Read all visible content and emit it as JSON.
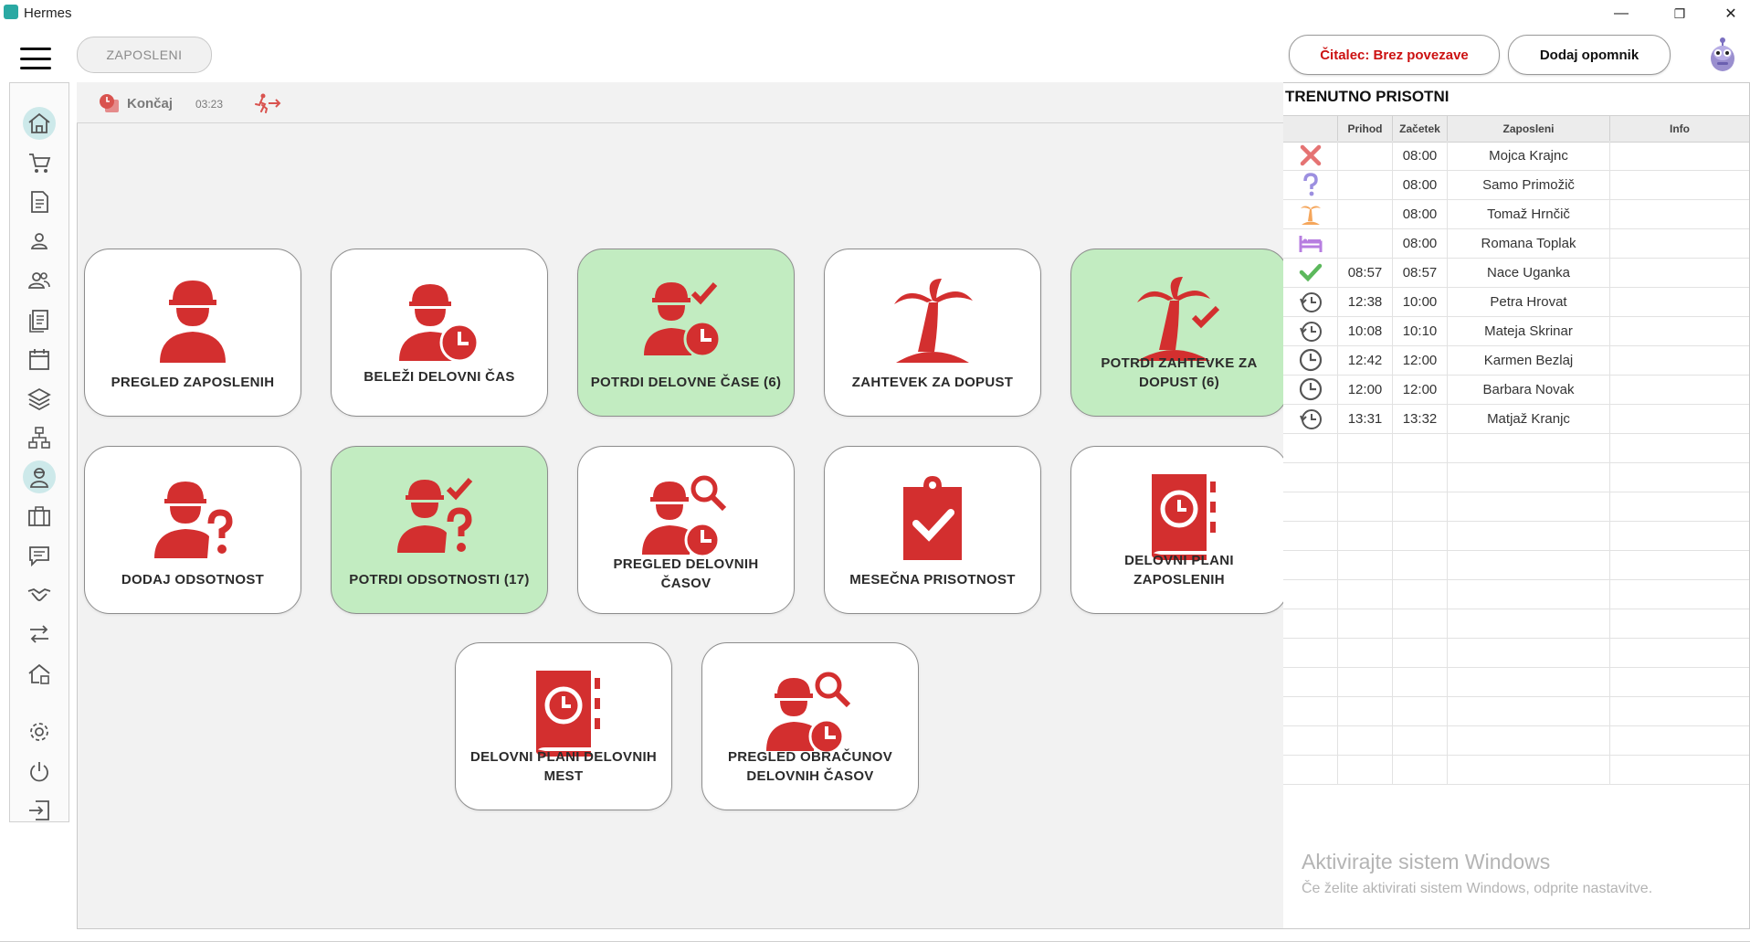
{
  "window": {
    "title": "Hermes",
    "minimize": "—",
    "maximize": "❐",
    "close": "✕"
  },
  "header": {
    "tab_label": "ZAPOSLENI",
    "reader_label": "Čitalec: Brez povezave",
    "reminder_label": "Dodaj opomnik"
  },
  "sidebar": {
    "items": [
      "home-icon",
      "cart-icon",
      "document-icon",
      "person-icon",
      "people-icon",
      "list-icon",
      "calendar-icon",
      "layers-icon",
      "hierarchy-icon",
      "employee-icon",
      "briefcase-icon",
      "chat-icon",
      "handshake-icon",
      "transfer-icon",
      "house-icon",
      "settings-icon",
      "power-icon",
      "logout-icon"
    ],
    "active": "employee-icon"
  },
  "toolbar": {
    "end_label": "Končaj",
    "time": "03:23"
  },
  "tiles": [
    {
      "label": "PREGLED ZAPOSLENIH",
      "icon": "worker-icon",
      "green": false
    },
    {
      "label": "BELEŽI DELOVNI ČAS",
      "icon": "worker-clock-icon",
      "green": false
    },
    {
      "label": "POTRDI DELOVNE ČASE (6)",
      "icon": "worker-clock-check-icon",
      "green": true
    },
    {
      "label": "ZAHTEVEK ZA DOPUST",
      "icon": "palm-icon",
      "green": false
    },
    {
      "label": "POTRDI ZAHTEVKE ZA DOPUST (6)",
      "icon": "palm-check-icon",
      "green": true
    },
    {
      "label": "DODAJ ODSOTNOST",
      "icon": "worker-question-icon",
      "green": false
    },
    {
      "label": "POTRDI ODSOTNOSTI (17)",
      "icon": "worker-question-check-icon",
      "green": true
    },
    {
      "label": "PREGLED DELOVNIH ČASOV",
      "icon": "worker-search-clock-icon",
      "green": false
    },
    {
      "label": "MESEČNA PRISOTNOST",
      "icon": "clipboard-check-icon",
      "green": false
    },
    {
      "label": "DELOVNI PLANI ZAPOSLENIH",
      "icon": "planner-clock-icon",
      "green": false
    },
    {
      "label": "DELOVNI PLANI DELOVNIH MEST",
      "icon": "planner-clock-icon",
      "green": false
    },
    {
      "label": "PREGLED OBRAČUNOV DELOVNIH ČASOV",
      "icon": "worker-search-clock-icon",
      "green": false
    }
  ],
  "panel": {
    "title": "TRENUTNO PRISOTNI",
    "columns": [
      "Prihod",
      "Začetek",
      "Zaposleni",
      "Info"
    ],
    "rows": [
      {
        "status": "absent-x-icon",
        "prihod": "",
        "zacetek": "08:00",
        "ime": "Mojca Krajnc"
      },
      {
        "status": "unknown-question-icon",
        "prihod": "",
        "zacetek": "08:00",
        "ime": "Samo Primožič"
      },
      {
        "status": "vacation-palm-icon",
        "prihod": "",
        "zacetek": "08:00",
        "ime": "Tomaž Hrnčič"
      },
      {
        "status": "sick-bed-icon",
        "prihod": "",
        "zacetek": "08:00",
        "ime": "Romana Toplak"
      },
      {
        "status": "present-check-icon",
        "prihod": "08:57",
        "zacetek": "08:57",
        "ime": "Nace Uganka"
      },
      {
        "status": "history-clock-icon",
        "prihod": "12:38",
        "zacetek": "10:00",
        "ime": "Petra Hrovat"
      },
      {
        "status": "history-clock-icon",
        "prihod": "10:08",
        "zacetek": "10:10",
        "ime": "Mateja Skrinar"
      },
      {
        "status": "clock-icon",
        "prihod": "12:42",
        "zacetek": "12:00",
        "ime": "Karmen Bezlaj"
      },
      {
        "status": "clock-icon",
        "prihod": "12:00",
        "zacetek": "12:00",
        "ime": "Barbara Novak"
      },
      {
        "status": "history-clock-icon",
        "prihod": "13:31",
        "zacetek": "13:32",
        "ime": "Matjaž Kranjc"
      }
    ]
  },
  "watermark": {
    "line1": "Aktivirajte sistem Windows",
    "line2": "Če želite aktivirati sistem Windows, odprite nastavitve."
  },
  "colors": {
    "icon_red": "#d32f2f",
    "tile_green": "#c2ecc1",
    "sidebar_active": "#cde9ea",
    "reader_red": "#cc1111"
  }
}
